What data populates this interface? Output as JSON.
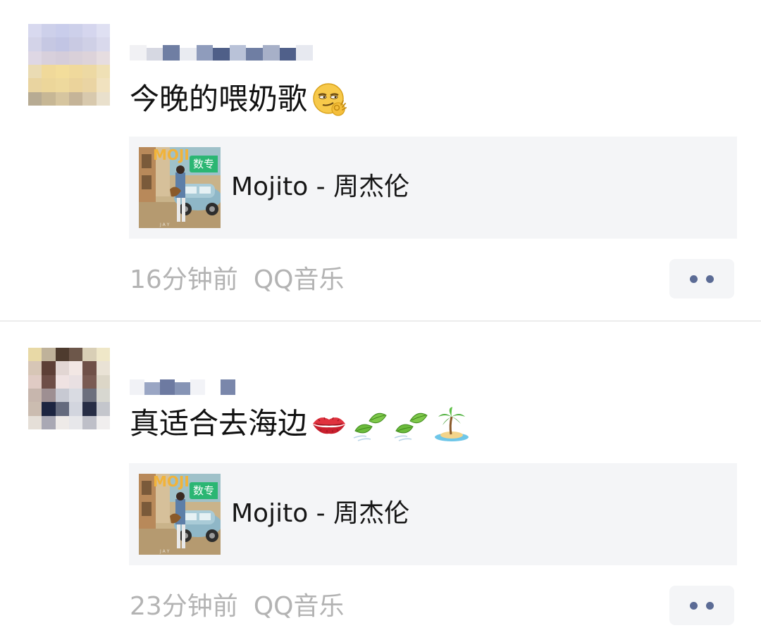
{
  "posts": [
    {
      "avatar_colors": [
        "#d8d9ef",
        "#cdd0ea",
        "#c9cdeb",
        "#cdd0ea",
        "#d5d6ee",
        "#dfe0f2",
        "#d3d3e8",
        "#c6c8e3",
        "#c2c5e4",
        "#c9cae3",
        "#cfd0e6",
        "#d9d9ec",
        "#ded7e4",
        "#d8d0dc",
        "#d5cdda",
        "#d9d0d9",
        "#ddd3da",
        "#e6dde0",
        "#eadbb3",
        "#f0d99a",
        "#f3dd9b",
        "#f0d99c",
        "#edd9a3",
        "#efe0b5",
        "#e9d4a0",
        "#ecd69a",
        "#eed99d",
        "#ebd39b",
        "#ead4a3",
        "#f1e2bf",
        "#b7ab93",
        "#c7b795",
        "#d6c59f",
        "#c5b498",
        "#d8c9ad",
        "#e9e0cc"
      ],
      "username_blocks": [
        "#f1f1f4",
        "#d6d8e2",
        "#6f7ea3",
        "#e9ebf1",
        "#8f9cbc",
        "#4f5f88",
        "#b9c2d8",
        "#6f7ea3",
        "#a7b0c8",
        "#50608a",
        "#e7e9f0"
      ],
      "text": "今晚的喂奶歌",
      "emoji": "smirk-ok-emoji",
      "music": {
        "badge": "数专",
        "title": "Mojito - 周杰伦"
      },
      "time": "16分钟前",
      "source": "QQ音乐"
    },
    {
      "avatar_colors": [
        "#e8d9a6",
        "#bfb29a",
        "#4e3b2e",
        "#6d574a",
        "#d9cfb6",
        "#efe7c8",
        "#d7c6b6",
        "#5d3f36",
        "#e2d6d3",
        "#f2e7e4",
        "#6f5048",
        "#e9e2d5",
        "#e0cbc4",
        "#6e4e47",
        "#efe2e2",
        "#e9e0e2",
        "#7a5b53",
        "#dcd6c7",
        "#c7b6ad",
        "#9e8f92",
        "#c7c9d2",
        "#d9dbe2",
        "#6c6f7d",
        "#d7d7d0",
        "#cbbcb0",
        "#1c2440",
        "#646a7d",
        "#d2d5de",
        "#272d45",
        "#c4c6cc",
        "#e5dfd8",
        "#a9a8b4",
        "#eeeae8",
        "#e7e7ea",
        "#bebfc8",
        "#f0eeee"
      ],
      "username_blocks": [
        "#f1f2f6",
        "#9aa6c4",
        "#6d7aa1",
        "#8694b5",
        "#f2f3f7",
        "#ffffff",
        "#7a87ab"
      ],
      "text": "真适合去海边",
      "emojis": [
        "kiss-lips-emoji",
        "leaf-emoji",
        "leaf-emoji",
        "palm-island-emoji"
      ],
      "music": {
        "badge": "数专",
        "title": "Mojito - 周杰伦"
      },
      "time": "23分钟前",
      "source": "QQ音乐"
    }
  ],
  "colors": {
    "card_bg": "#f4f5f7",
    "meta_text": "#b3b3b3",
    "more_dots": "#5b6b95",
    "badge_green": "#2bb673"
  }
}
